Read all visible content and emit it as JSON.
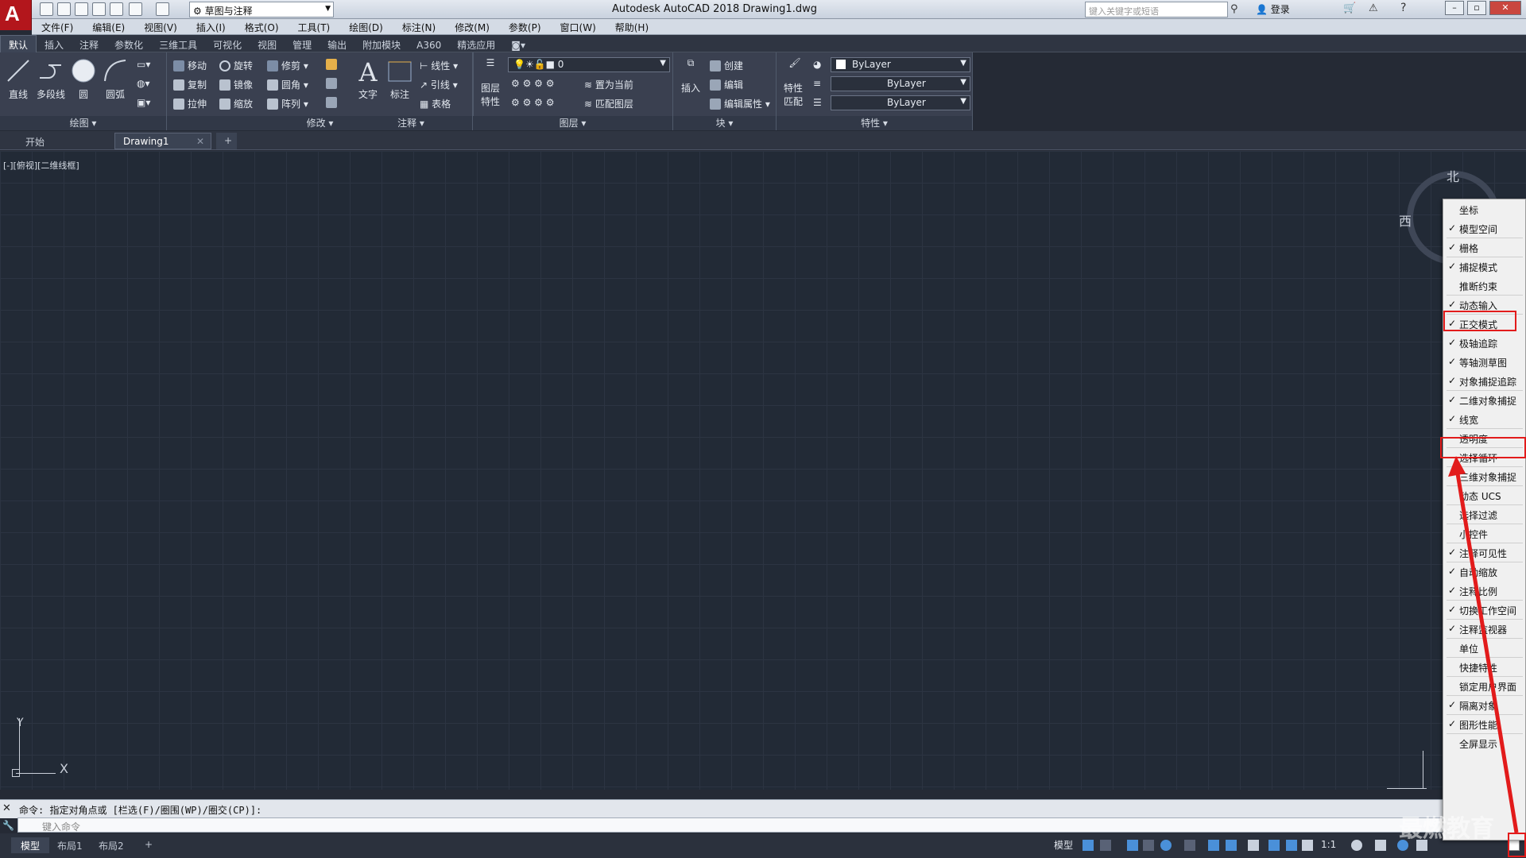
{
  "app": {
    "title": "Autodesk AutoCAD 2018    Drawing1.dwg",
    "logo": "A",
    "workspace": "草图与注释",
    "search_placeholder": "键入关键字或短语",
    "login": "登录"
  },
  "menus": [
    "文件(F)",
    "编辑(E)",
    "视图(V)",
    "插入(I)",
    "格式(O)",
    "工具(T)",
    "绘图(D)",
    "标注(N)",
    "修改(M)",
    "参数(P)",
    "窗口(W)",
    "帮助(H)"
  ],
  "ribbon_tabs": [
    "默认",
    "插入",
    "注释",
    "参数化",
    "三维工具",
    "可视化",
    "视图",
    "管理",
    "输出",
    "附加模块",
    "A360",
    "精选应用"
  ],
  "draw": {
    "label": "绘图",
    "line": "直线",
    "pline": "多段线",
    "circle": "圆",
    "arc": "圆弧"
  },
  "modify": {
    "label": "修改",
    "move": "移动",
    "rotate": "旋转",
    "trim": "修剪",
    "copy": "复制",
    "mirror": "镜像",
    "fillet": "圆角",
    "stretch": "拉伸",
    "scale": "缩放",
    "array": "阵列"
  },
  "annotate": {
    "label": "注释",
    "text": "文字",
    "dim": "标注",
    "linear": "线性",
    "leader": "引线",
    "table": "表格"
  },
  "layers": {
    "label": "图层",
    "props1": "图层",
    "props2": "特性",
    "current": "0",
    "setcurrent": "置为当前",
    "match": "匹配图层"
  },
  "block": {
    "label": "块",
    "insert": "插入",
    "create": "创建",
    "edit": "编辑",
    "editattr": "编辑属性"
  },
  "properties": {
    "label": "特性",
    "match1": "特性",
    "match2": "匹配",
    "color": "ByLayer",
    "linetype": "ByLayer",
    "lineweight": "ByLayer"
  },
  "doc_tabs": {
    "start": "开始",
    "drawing": "Drawing1"
  },
  "viewport_label": "[-][俯视][二维线框]",
  "compass": {
    "n": "北",
    "w": "西"
  },
  "ucs": {
    "y": "Y",
    "x": "X"
  },
  "command": {
    "history": "命令: 指定对角点或 [栏选(F)/圈围(WP)/圈交(CP)]:",
    "placeholder": "键入命令"
  },
  "layout_tabs": [
    "模型",
    "布局1",
    "布局2"
  ],
  "status": {
    "model": "模型",
    "scale": "1:1"
  },
  "context_menu": [
    {
      "label": "坐标",
      "checked": false
    },
    {
      "label": "模型空间",
      "checked": true
    },
    {
      "label": "栅格",
      "checked": true
    },
    {
      "label": "捕捉模式",
      "checked": true
    },
    {
      "label": "推断约束",
      "checked": false
    },
    {
      "label": "动态输入",
      "checked": true
    },
    {
      "label": "正交模式",
      "checked": true
    },
    {
      "label": "极轴追踪",
      "checked": true
    },
    {
      "label": "等轴测草图",
      "checked": true
    },
    {
      "label": "对象捕捉追踪",
      "checked": true
    },
    {
      "label": "二维对象捕捉",
      "checked": true
    },
    {
      "label": "线宽",
      "checked": true
    },
    {
      "label": "透明度",
      "checked": false
    },
    {
      "label": "选择循环",
      "checked": false
    },
    {
      "label": "三维对象捕捉",
      "checked": false
    },
    {
      "label": "动态 UCS",
      "checked": false
    },
    {
      "label": "选择过滤",
      "checked": false
    },
    {
      "label": "小控件",
      "checked": false
    },
    {
      "label": "注释可见性",
      "checked": true
    },
    {
      "label": "自动缩放",
      "checked": true
    },
    {
      "label": "注释比例",
      "checked": true
    },
    {
      "label": "切换工作空间",
      "checked": true
    },
    {
      "label": "注释监视器",
      "checked": true
    },
    {
      "label": "单位",
      "checked": false
    },
    {
      "label": "快捷特性",
      "checked": false
    },
    {
      "label": "锁定用户界面",
      "checked": false
    },
    {
      "label": "隔离对象",
      "checked": true
    },
    {
      "label": "图形性能",
      "checked": true
    },
    {
      "label": "全屏显示",
      "checked": false
    }
  ],
  "watermark": "最燃教育",
  "colors": {
    "highlight": "#e21b1b",
    "canvas": "#222a36",
    "logo": "#b3161c"
  }
}
